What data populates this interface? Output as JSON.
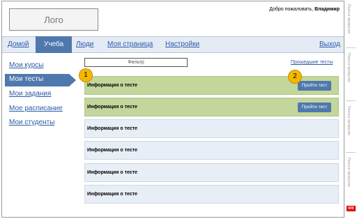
{
  "header": {
    "logo_text": "Лого",
    "welcome_prefix": "Добро пожаловать,",
    "username": "Владимир"
  },
  "nav": {
    "items": [
      {
        "label": "Домой"
      },
      {
        "label": "Учеба"
      },
      {
        "label": "Люди"
      },
      {
        "label": "Моя страница"
      },
      {
        "label": "Настройки"
      }
    ],
    "active": "Учеба",
    "logout": "Выход"
  },
  "sidebar": {
    "items": [
      {
        "label": "Мои курсы"
      },
      {
        "label": "Мои тесты"
      },
      {
        "label": "Мои задания"
      },
      {
        "label": "Мое расписание"
      },
      {
        "label": "Мои студенты"
      }
    ],
    "active": "Мои тесты"
  },
  "filter": {
    "placeholder": "Фильтр"
  },
  "past_tests_link": "Прошедшие тесты",
  "tests": [
    {
      "label": "Информация о тесте",
      "button": "Пройти тест",
      "highlighted": true
    },
    {
      "label": "Информация о тесте",
      "button": "Пройти тест",
      "highlighted": true
    },
    {
      "label": "Информация о тесте"
    },
    {
      "label": "Информация о тесте"
    },
    {
      "label": "Информация о тесте"
    },
    {
      "label": "Информация о тесте"
    }
  ],
  "annotations": [
    "1",
    "2"
  ],
  "right_column": {
    "labels": [
      "Полоса прокрутки",
      "Полоса прокрутки",
      "Полоса прокрутки",
      "Полоса прокрутки"
    ],
    "corner": "600"
  },
  "colors": {
    "nav_active": "#4f78ad",
    "row_highlight": "#c3d69b",
    "row_default": "#e8eef6",
    "badge": "#f5b800",
    "link": "#2a5aa8"
  }
}
